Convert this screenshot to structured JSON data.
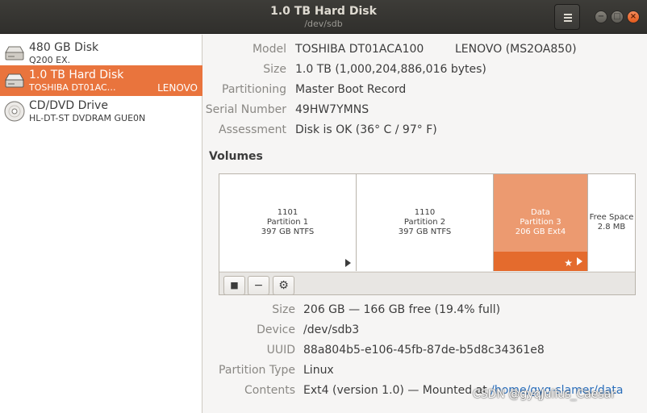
{
  "window": {
    "title": "1.0 TB Hard Disk",
    "subtitle": "/dev/sdb",
    "close": "×",
    "minimize": "−",
    "maximize": "□"
  },
  "sidebar": {
    "drives": [
      {
        "name": "480 GB Disk",
        "sub": "Q200 EX.",
        "vendor": "",
        "icon": "hard-disk-icon"
      },
      {
        "name": "1.0 TB Hard Disk",
        "sub": "TOSHIBA DT01AC…",
        "vendor": "LENOVO",
        "icon": "hard-disk-icon",
        "selected": true
      },
      {
        "name": "CD/DVD Drive",
        "sub": "HL-DT-ST DVDRAM GUE0N",
        "vendor": "",
        "icon": "optical-disc-icon"
      }
    ]
  },
  "disk_info": {
    "model_label": "Model",
    "model_value": "TOSHIBA DT01ACA100",
    "model_vendor": "LENOVO (MS2OA850)",
    "size_label": "Size",
    "size_value": "1.0 TB (1,000,204,886,016 bytes)",
    "partitioning_label": "Partitioning",
    "partitioning_value": "Master Boot Record",
    "serial_label": "Serial Number",
    "serial_value": "49HW7YMNS",
    "assessment_label": "Assessment",
    "assessment_value": "Disk is OK (36° C / 97° F)"
  },
  "volumes": {
    "title": "Volumes",
    "partitions": [
      {
        "line1": "1101",
        "line2": "Partition 1",
        "line3": "397 GB NTFS"
      },
      {
        "line1": "1110",
        "line2": "Partition 2",
        "line3": "397 GB NTFS"
      },
      {
        "line1": "Data",
        "line2": "Partition 3",
        "line3": "206 GB Ext4",
        "selected": true
      },
      {
        "line1": "Free Space",
        "line2": "2.8 MB"
      }
    ],
    "toolbar": {
      "stop": "■",
      "delete": "−",
      "settings": "⚙"
    }
  },
  "partition_info": {
    "size_label": "Size",
    "size_value": "206 GB — 166 GB free (19.4% full)",
    "device_label": "Device",
    "device_value": "/dev/sdb3",
    "uuid_label": "UUID",
    "uuid_value": "88a804b5-e106-45fb-87de-b5d8c34361e8",
    "type_label": "Partition Type",
    "type_value": "Linux",
    "contents_label": "Contents",
    "contents_prefix": "Ext4 (version 1.0) — Mounted at ",
    "contents_link": "/home/gyq-slamer/data"
  },
  "watermark": "CSDN @gyqJulius_Caesar",
  "colors": {
    "accent": "#e9743d",
    "selected_partition": "#ec9a70",
    "headerbar": "#353431"
  }
}
